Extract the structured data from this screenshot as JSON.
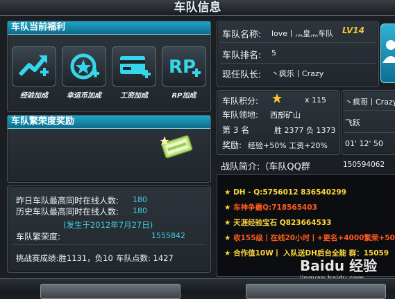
{
  "window": {
    "title": "车队信息"
  },
  "benefits": {
    "header": "车队当前福利",
    "items": [
      {
        "label": "经验加成",
        "icon": "xp-boost-icon"
      },
      {
        "label": "幸运币加成",
        "icon": "lucky-coin-icon"
      },
      {
        "label": "工资加成",
        "icon": "salary-card-icon"
      },
      {
        "label": "RP加成",
        "icon": "rp-plus-icon"
      }
    ]
  },
  "prosperity_reward": {
    "header": "车队繁荣度奖励"
  },
  "stats": {
    "yesterday_label": "昨日车队最高同时在线人数:",
    "yesterday_value": "180",
    "history_label": "历史车队最高同时在线人数:",
    "history_value": "180",
    "date_note": "(发生于2012年7月27日)",
    "prosperity_label": "车队繁荣度:",
    "prosperity_value": "1555842",
    "challenge_text": "挑战赛成绩:胜1131，负10",
    "points_text": "车队点数: 1427"
  },
  "team": {
    "name_label": "车队名称:",
    "name_value": "love丨灬皇灬车队",
    "level": "LV14",
    "rank_label": "车队排名:",
    "rank_value": "5",
    "captain_label": "现任队长:",
    "captain_value": "丶疯乐丨Crazy",
    "points_label": "车队积分:",
    "points_value": "x 115",
    "territory_label": "车队领地:",
    "territory_value": "西部矿山",
    "place_text": "第 3 名",
    "win_text": "胜 2377",
    "loss_text": "负 1373",
    "reward_label": "奖励:",
    "reward_value": "经验+50% 工资+20%",
    "side_name": "丶疯哥丨Crazy",
    "side_fly": "飞跃",
    "side_time": "01' 12' 50",
    "intro_label": "战队简介:（车队QQ群",
    "intro_qq": "150594062"
  },
  "intro_lines": [
    {
      "text": "DH - Q:5756012 836540299",
      "color": "#ffd83a"
    },
    {
      "text": "车神争霸Q:718565403",
      "color": "#ff5a1e"
    },
    {
      "text": "天涯经验宝石 Q823664533",
      "color": "#ffd83a"
    },
    {
      "text": "收155级丨在线20小时丨+更名+4000繁荣+50",
      "color": "#ff5a1e"
    },
    {
      "text": "合作值10W丨 入队送DH后台全能   群：15059",
      "color": "#ffd83a"
    }
  ],
  "watermark": {
    "text": "Baidu 经验",
    "url": "jingyan.baidu.com"
  },
  "colors": {
    "accent": "#1fa5c8",
    "cyan_value": "#46d0e6",
    "gold": "#ffd83a",
    "orange": "#ff5a1e"
  }
}
